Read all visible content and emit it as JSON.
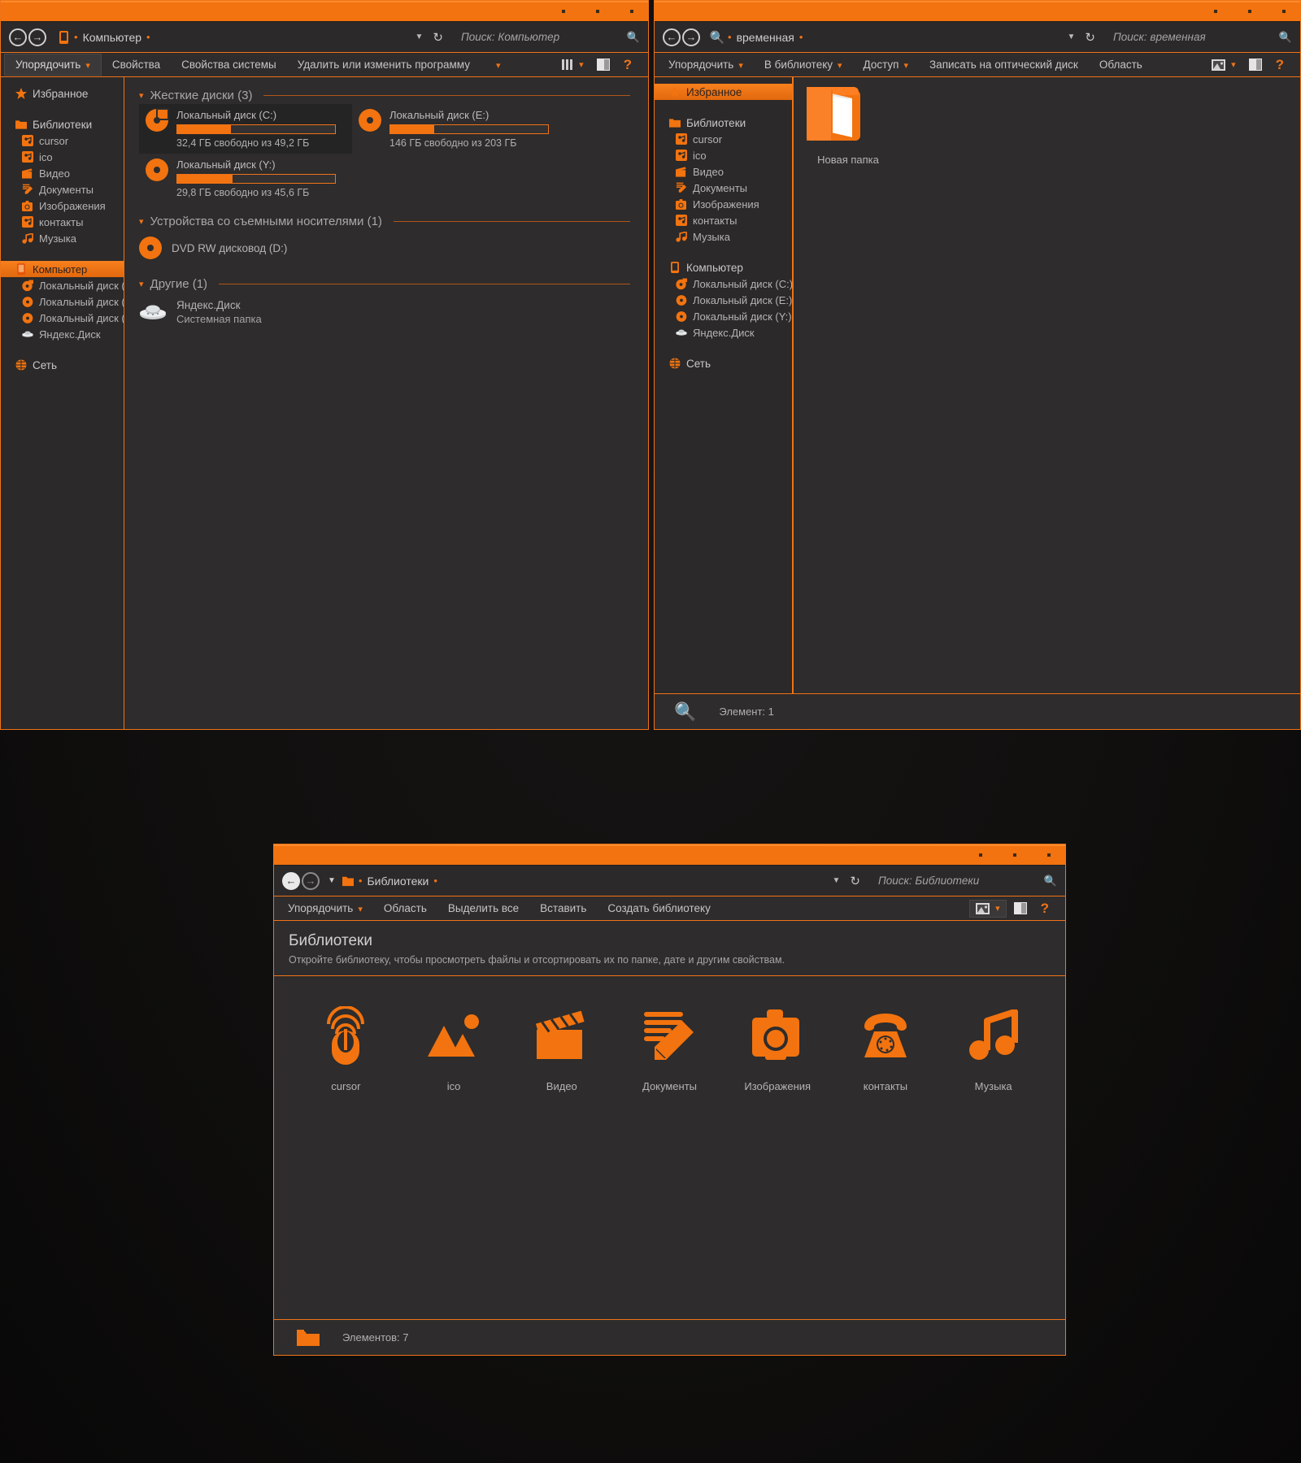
{
  "theme": {
    "accent": "#f2730f",
    "window_bg": "#2e2c2c",
    "sidebar_bg": "#2b2929",
    "text": "#b5b3b3"
  },
  "window_computer": {
    "address": {
      "crumb": "Компьютер",
      "search_placeholder": "Поиск: Компьютер"
    },
    "toolbar": {
      "organize": "Упорядочить",
      "properties": "Свойства",
      "system_properties": "Свойства системы",
      "uninstall_change": "Удалить или изменить программу"
    },
    "sidebar": {
      "favorites": "Избранное",
      "libraries_head": "Библиотеки",
      "libraries": [
        "cursor",
        "ico",
        "Видео",
        "Документы",
        "Изображения",
        "контакты",
        "Музыка"
      ],
      "computer_head": "Компьютер",
      "computer_children": [
        "Локальный диск (C:)",
        "Локальный диск (E:)",
        "Локальный диск (Y:)",
        "Яндекс.Диск"
      ],
      "network": "Сеть"
    },
    "groups": {
      "hard_disks": "Жесткие диски (3)",
      "removable": "Устройства со съемными носителями (1)",
      "others": "Другие (1)"
    },
    "drives": [
      {
        "name": "Локальный диск (C:)",
        "free": "32,4 ГБ свободно из 49,2 ГБ",
        "used_pct": 34,
        "selected": true,
        "icon": "disc-system-icon"
      },
      {
        "name": "Локальный диск (E:)",
        "free": "146 ГБ свободно из 203 ГБ",
        "used_pct": 28,
        "selected": false,
        "icon": "disc-icon"
      },
      {
        "name": "Локальный диск (Y:)",
        "free": "29,8 ГБ свободно из 45,6 ГБ",
        "used_pct": 35,
        "selected": false,
        "icon": "disc-icon"
      }
    ],
    "removable": [
      {
        "name": "DVD RW дисковод (D:)",
        "icon": "disc-icon"
      }
    ],
    "others": [
      {
        "name": "Яндекс.Диск",
        "subtitle": "Системная папка",
        "icon": "yandex-disk-icon"
      }
    ]
  },
  "window_temp": {
    "address": {
      "crumb": "временная",
      "search_placeholder": "Поиск: временная"
    },
    "toolbar": {
      "organize": "Упорядочить",
      "to_library": "В библиотеку",
      "share": "Доступ",
      "burn": "Записать на оптический диск",
      "pane": "Область"
    },
    "sidebar": {
      "favorites": "Избранное",
      "libraries_head": "Библиотеки",
      "libraries": [
        "cursor",
        "ico",
        "Видео",
        "Документы",
        "Изображения",
        "контакты",
        "Музыка"
      ],
      "computer_head": "Компьютер",
      "computer_children": [
        "Локальный диск (C:)",
        "Локальный диск (E:)",
        "Локальный диск (Y:)",
        "Яндекс.Диск"
      ],
      "network": "Сеть"
    },
    "items": [
      {
        "name": "Новая папка",
        "icon": "folder-icon"
      }
    ],
    "status": "Элемент: 1"
  },
  "window_libraries": {
    "address": {
      "crumb": "Библиотеки",
      "search_placeholder": "Поиск: Библиотеки"
    },
    "toolbar": {
      "organize": "Упорядочить",
      "pane": "Область",
      "select_all": "Выделить все",
      "paste": "Вставить",
      "create_library": "Создать библиотеку"
    },
    "header": {
      "title": "Библиотеки",
      "subtitle": "Откройте библиотеку, чтобы просмотреть файлы и отсортировать их по папке, дате и другим свойствам."
    },
    "items": [
      {
        "name": "cursor",
        "icon": "mouse-cursor-icon"
      },
      {
        "name": "ico",
        "icon": "picture-icon"
      },
      {
        "name": "Видео",
        "icon": "clapperboard-icon"
      },
      {
        "name": "Документы",
        "icon": "pencil-document-icon"
      },
      {
        "name": "Изображения",
        "icon": "camera-icon"
      },
      {
        "name": "контакты",
        "icon": "telephone-icon"
      },
      {
        "name": "Музыка",
        "icon": "music-note-icon"
      }
    ],
    "status": "Элементов: 7"
  }
}
